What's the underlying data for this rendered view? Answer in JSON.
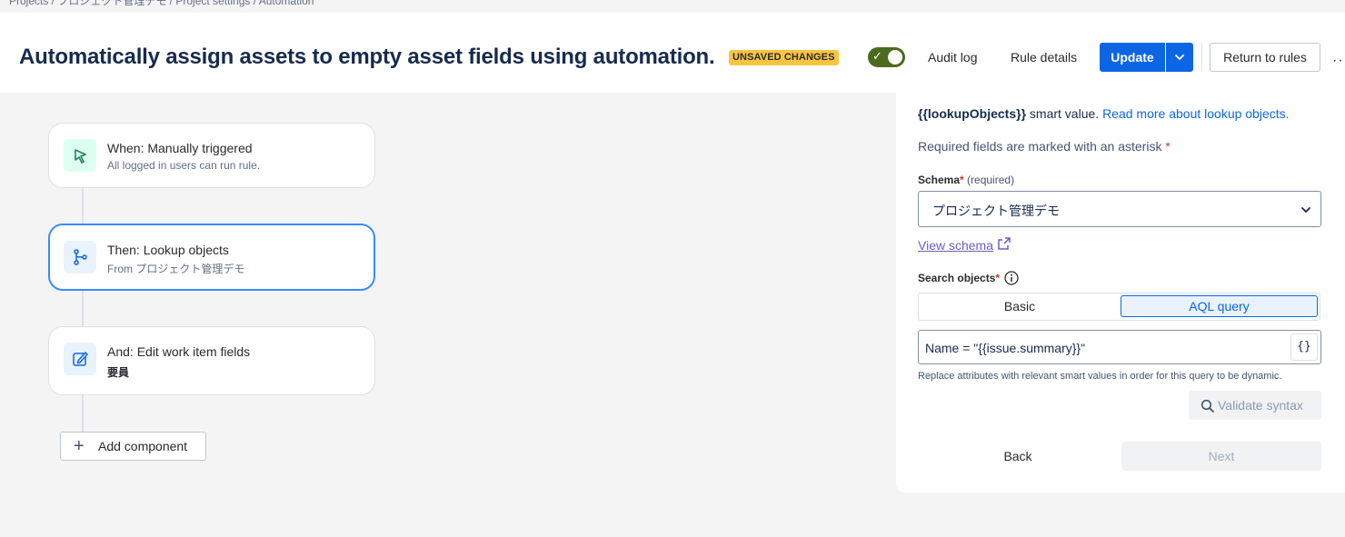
{
  "breadcrumb": "Projects / プロジェクト管理デモ / Project settings / Automation",
  "header": {
    "title": "Automatically assign assets to empty asset fields using automation.",
    "status_lozenge": "UNSAVED CHANGES",
    "toggle_enabled": true,
    "audit_log": "Audit log",
    "rule_details": "Rule details",
    "update": "Update",
    "return_to_rules": "Return to rules",
    "more": "···"
  },
  "rule": {
    "components": [
      {
        "title": "When: Manually triggered",
        "subtitle": "All logged in users can run rule.",
        "icon": "cursor-click-icon",
        "color": "#1f845a",
        "bg": "#dcfff1"
      },
      {
        "title": "Then: Lookup objects",
        "subtitle": "From プロジェクト管理デモ",
        "icon": "branch-icon",
        "color": "#0c66e4",
        "bg": "#e9f2ff"
      },
      {
        "title": "And: Edit work item fields",
        "subtitle": "要員",
        "icon": "edit-icon",
        "color": "#0c66e4",
        "bg": "#e9f2ff"
      }
    ],
    "add_component": "Add component"
  },
  "panel": {
    "intro_smart_value": "{{lookupObjects}}",
    "intro_text": " smart value.",
    "intro_link": "Read more about lookup objects.",
    "required_note": "Required fields are marked with an asterisk",
    "required_mark": "*",
    "schema_label": "Schema",
    "schema_required": "(required)",
    "schema_value": "プロジェクト管理デモ",
    "view_schema": "View schema",
    "search_label": "Search objects",
    "tabs": {
      "basic": "Basic",
      "aql": "AQL query",
      "selected": "AQL query"
    },
    "aql_value": "Name = \"{{issue.summary}}\"",
    "smart_value_button": "{}",
    "hint": "Replace attributes with relevant smart values in order for this query to be dynamic.",
    "validate": "Validate syntax",
    "back": "Back",
    "next": "Next"
  },
  "colors": {
    "accent": "#0c66e4",
    "lozenge": "#f8c540",
    "toggle": "#4c6b1f"
  }
}
